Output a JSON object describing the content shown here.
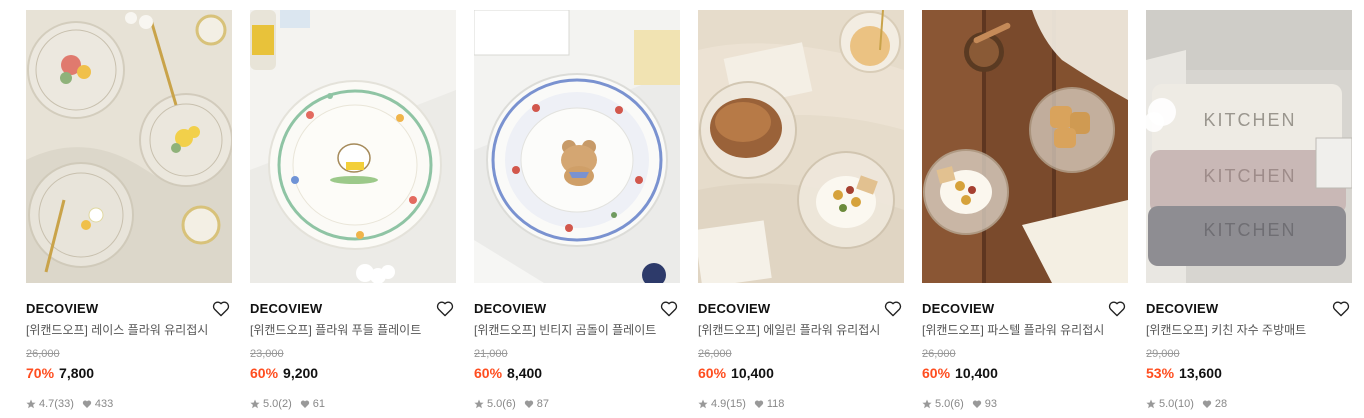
{
  "products": [
    {
      "brand": "DECOVIEW",
      "title": "[위캔드오프] 레이스 플라워 유리접시",
      "original_price": "26,000",
      "discount": "70%",
      "price": "7,800",
      "rating": "4.7",
      "reviews": "(33)",
      "likes": "433"
    },
    {
      "brand": "DECOVIEW",
      "title": "[위캔드오프] 플라워 푸들 플레이트",
      "original_price": "23,000",
      "discount": "60%",
      "price": "9,200",
      "rating": "5.0",
      "reviews": "(2)",
      "likes": "61"
    },
    {
      "brand": "DECOVIEW",
      "title": "[위캔드오프] 빈티지 곰돌이 플레이트",
      "original_price": "21,000",
      "discount": "60%",
      "price": "8,400",
      "rating": "5.0",
      "reviews": "(6)",
      "likes": "87"
    },
    {
      "brand": "DECOVIEW",
      "title": "[위캔드오프] 에일린 플라워 유리접시",
      "original_price": "26,000",
      "discount": "60%",
      "price": "10,400",
      "rating": "4.9",
      "reviews": "(15)",
      "likes": "118"
    },
    {
      "brand": "DECOVIEW",
      "title": "[위캔드오프] 파스텔 플라워 유리접시",
      "original_price": "26,000",
      "discount": "60%",
      "price": "10,400",
      "rating": "5.0",
      "reviews": "(6)",
      "likes": "93"
    },
    {
      "brand": "DECOVIEW",
      "title": "[위캔드오프] 키친 자수 주방매트",
      "original_price": "29,000",
      "discount": "53%",
      "price": "13,600",
      "rating": "5.0",
      "reviews": "(10)",
      "likes": "28"
    }
  ],
  "images": {
    "kitchen_mat_text": "KITCHEN"
  },
  "colors": {
    "discount": "#ff4d1f",
    "brand": "#111111",
    "meta": "#888888"
  },
  "icons": {
    "wishlist": "heart-outline-icon",
    "rating": "star-icon",
    "likes": "heart-filled-icon"
  }
}
